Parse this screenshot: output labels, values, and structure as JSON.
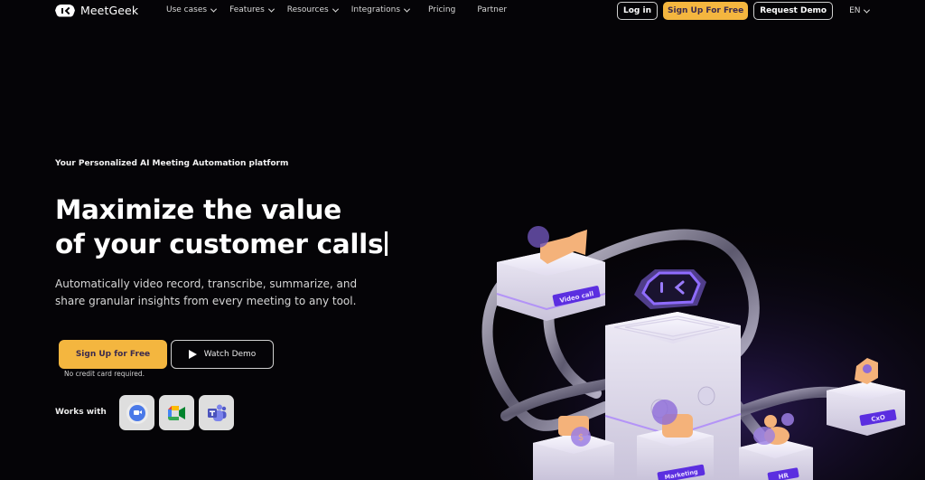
{
  "nav": {
    "brand": "MeetGeek",
    "menu": [
      {
        "label": "Use cases",
        "dropdown": true
      },
      {
        "label": "Features",
        "dropdown": true
      },
      {
        "label": "Resources",
        "dropdown": true
      },
      {
        "label": "Integrations",
        "dropdown": true
      },
      {
        "label": "Pricing",
        "dropdown": false
      },
      {
        "label": "Partner",
        "dropdown": false
      }
    ],
    "login": "Log in",
    "signup": "Sign Up For Free",
    "request_demo": "Request Demo",
    "language": "EN"
  },
  "hero": {
    "eyebrow": "Your Personalized AI Meeting Automation platform",
    "headline_line1": "Maximize the value",
    "headline_line2": "of your customer calls",
    "subtext": "Automatically video record, transcribe, summarize, and share granular insights from every meeting to any tool.",
    "primary_cta": "Sign Up for Free",
    "secondary_cta": "Watch Demo",
    "note": "No credit card required.",
    "works_with_label": "Works with",
    "integrations": [
      "zoom-icon",
      "google-meet-icon",
      "microsoft-teams-icon"
    ]
  },
  "illustration": {
    "labels": {
      "video_call": "Video call",
      "marketing": "Marketing",
      "hr": "HR",
      "cxo": "CxO"
    }
  },
  "colors": {
    "background": "#050407",
    "accent_yellow": "#f4b63f",
    "accent_purple": "#7a52e6",
    "block_white": "#ece8f4",
    "peach": "#f4b27a"
  }
}
